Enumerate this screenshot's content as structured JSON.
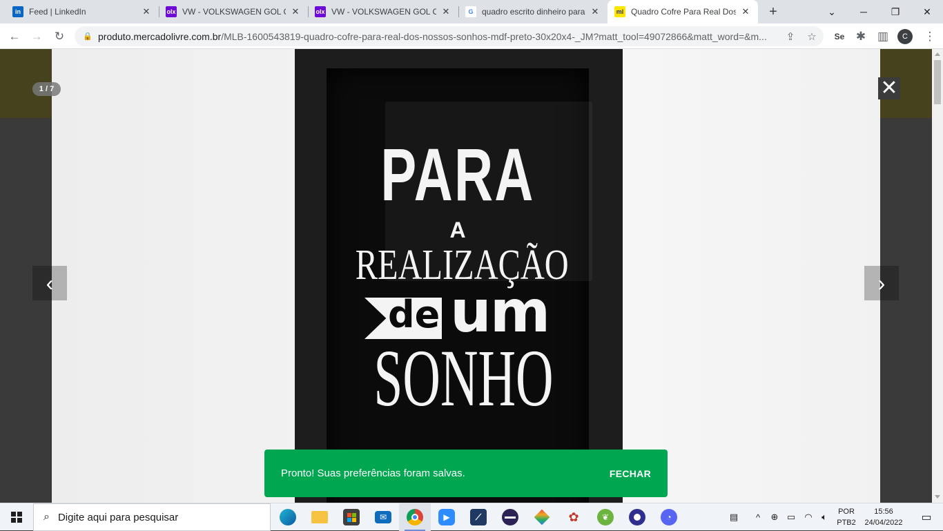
{
  "browser": {
    "tabs": [
      {
        "title": "Feed | LinkedIn",
        "favicon": "linkedin-icon",
        "favicon_text": "in",
        "active": false
      },
      {
        "title": "VW - VOLKSWAGEN GOL CLI",
        "favicon": "olx-icon",
        "favicon_text": "olx",
        "active": false
      },
      {
        "title": "VW - VOLKSWAGEN GOL CIT",
        "favicon": "olx-icon",
        "favicon_text": "olx",
        "active": false
      },
      {
        "title": "quadro escrito dinheiro para",
        "favicon": "google-icon",
        "favicon_text": "G",
        "active": false
      },
      {
        "title": "Quadro Cofre Para Real Dos",
        "favicon": "mercadolivre-icon",
        "favicon_text": "ml",
        "active": true
      }
    ],
    "new_tab": "+",
    "window_controls": {
      "minimize": "─",
      "maximize": "❐",
      "close": "✕",
      "tab_search": "⌄"
    },
    "url": {
      "domain": "produto.mercadolivre.com.br",
      "path": "/MLB-1600543819-quadro-cofre-para-real-dos-nossos-sonhos-mdf-preto-30x20x4-_JM?matt_tool=49072866&matt_word=&m..."
    },
    "profile_initial": "C"
  },
  "lightbox": {
    "counter": "1 / 7",
    "close": "✕",
    "prev": "‹",
    "next": "›",
    "image_text": {
      "line1": "PARA",
      "line2": "A",
      "line3": "REALIZAÇÃO",
      "line4a": "de",
      "line4b": "um",
      "line5": "SONHO"
    }
  },
  "toast": {
    "message": "Pronto! Suas preferências foram salvas.",
    "action": "FECHAR",
    "color": "#00a650"
  },
  "taskbar": {
    "search_placeholder": "Digite aqui para pesquisar",
    "apps": [
      {
        "name": "edge-icon"
      },
      {
        "name": "file-explorer-icon"
      },
      {
        "name": "store-icon"
      },
      {
        "name": "mail-icon"
      },
      {
        "name": "chrome-icon",
        "active": true
      },
      {
        "name": "zoom-icon"
      },
      {
        "name": "sql-server-icon"
      },
      {
        "name": "eclipse-icon"
      },
      {
        "name": "git-icon"
      },
      {
        "name": "paint-icon"
      },
      {
        "name": "spring-icon"
      },
      {
        "name": "app-purple-icon"
      },
      {
        "name": "discord-icon"
      }
    ],
    "lang_line1": "POR",
    "lang_line2": "PTB2",
    "time": "15:56",
    "date": "24/04/2022"
  }
}
